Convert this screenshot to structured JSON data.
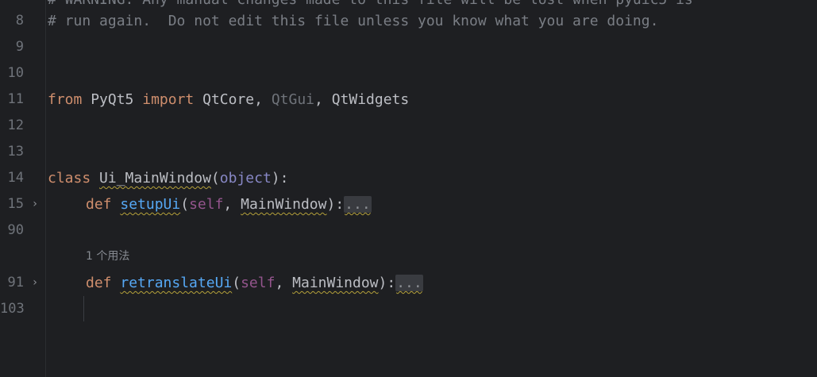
{
  "top_partial_comment": "# WARNING: Any manual changes made to this file will be lost when pyuic5 is",
  "lines": [
    {
      "num": "8",
      "comment": "# run again.  Do not edit this file unless you know what you are doing."
    },
    {
      "num": "9"
    },
    {
      "num": "10"
    },
    {
      "num": "11",
      "from": "from",
      "module": "PyQt5",
      "import": "import",
      "mod1": "QtCore",
      "comma1": ", ",
      "mod2": "QtGui",
      "comma2": ", ",
      "mod3": "QtWidgets"
    },
    {
      "num": "12"
    },
    {
      "num": "13"
    },
    {
      "num": "14",
      "class_kw": "class",
      "class_name": "Ui_MainWindow",
      "open_paren": "(",
      "base": "object",
      "close": "):"
    },
    {
      "num": "15",
      "def_kw": "def",
      "fn_name": "setupUi",
      "open_paren": "(",
      "self": "self",
      "comma": ", ",
      "param": "MainWindow",
      "close": "):",
      "folded": "..."
    },
    {
      "num": "90"
    },
    {
      "usage_hint": "1 个用法"
    },
    {
      "num": "91",
      "def_kw": "def",
      "fn_name": "retranslateUi",
      "open_paren": "(",
      "self": "self",
      "comma": ", ",
      "param": "MainWindow",
      "close": "):",
      "folded": "..."
    },
    {
      "num": "103"
    }
  ],
  "colors": {
    "background": "#1e1f22",
    "keyword": "#cf8e6d",
    "comment": "#7a7e85",
    "function": "#56a8f5",
    "self": "#94558d",
    "builtin": "#8888c6",
    "line_number": "#6f737a"
  },
  "icons": {
    "fold": "chevron-right-icon"
  }
}
